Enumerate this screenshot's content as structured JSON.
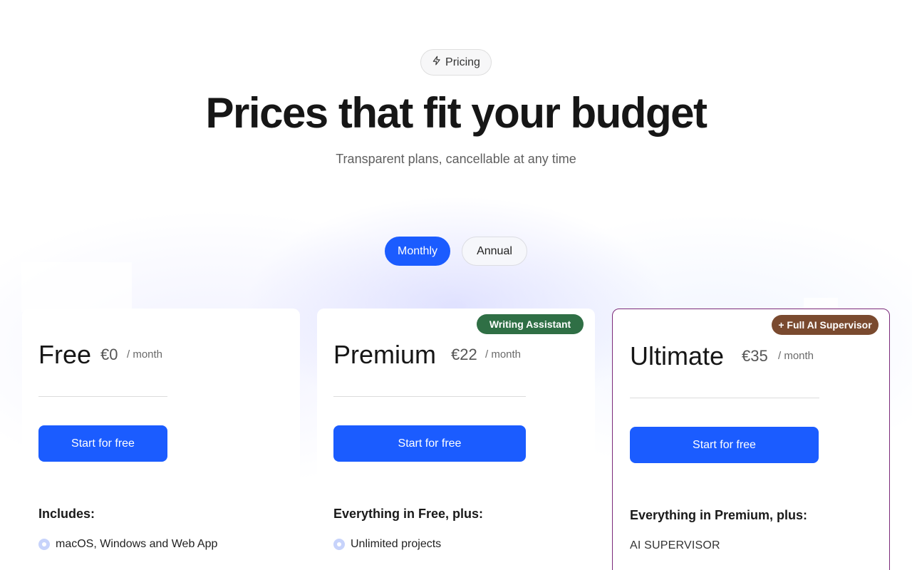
{
  "header": {
    "pill_label": "Pricing",
    "pill_icon": "lightning-icon",
    "title": "Prices that fit your budget",
    "subtitle": "Transparent plans, cancellable at any time"
  },
  "billing_toggle": {
    "options": [
      "Monthly",
      "Annual"
    ],
    "selected": "Monthly",
    "accent_color": "#1b5cff"
  },
  "plans": [
    {
      "name": "Free",
      "price": "€0",
      "period": "/ month",
      "cta": "Start for free",
      "features_title": "Includes:",
      "features": [
        "macOS, Windows and Web App"
      ]
    },
    {
      "name": "Premium",
      "price": "€22",
      "period": "/ month",
      "badge": "Writing Assistant",
      "badge_color": "#2f6f45",
      "cta": "Start for free",
      "features_title": "Everything in Free, plus:",
      "features": [
        "Unlimited projects"
      ]
    },
    {
      "name": "Ultimate",
      "price": "€35",
      "period": "/ month",
      "badge": "+ Full AI Supervisor",
      "badge_color": "#7a4a2f",
      "border_color": "#7b2a7a",
      "cta": "Start for free",
      "features_title": "Everything in Premium, plus:",
      "features": [
        "AI SUPERVISOR"
      ]
    }
  ]
}
